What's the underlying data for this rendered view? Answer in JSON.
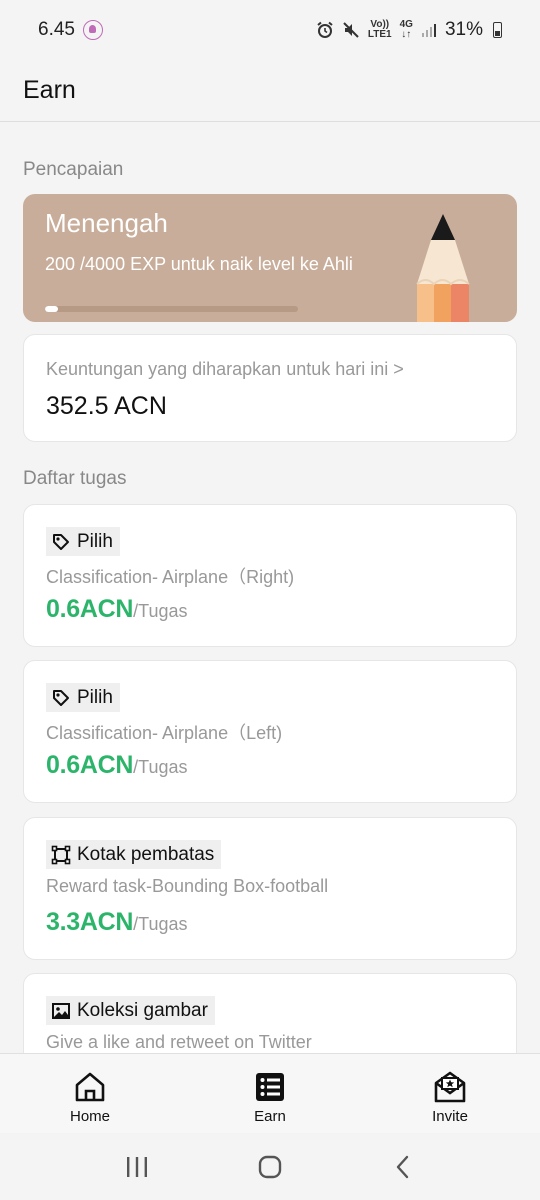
{
  "status_bar": {
    "time": "6.45",
    "volte_top": "Vo))",
    "volte_bottom": "LTE1",
    "network": "4G",
    "battery": "31%"
  },
  "header": {
    "title": "Earn"
  },
  "achievement": {
    "section_label": "Pencapaian",
    "level_name": "Menengah",
    "progress_text": "200 /4000 EXP untuk naik level ke Ahli",
    "progress_fraction": 0.05
  },
  "earnings": {
    "label": "Keuntungan yang diharapkan untuk hari ini >",
    "value": "352.5 ACN"
  },
  "tasks": {
    "section_label": "Daftar tugas",
    "items": [
      {
        "tag": "Pilih",
        "icon": "tag-icon",
        "desc": "Classification- Airplane（Right)",
        "amount": "0.6ACN",
        "unit": "/Tugas"
      },
      {
        "tag": "Pilih",
        "icon": "tag-icon",
        "desc": "Classification- Airplane（Left)",
        "amount": "0.6ACN",
        "unit": "/Tugas"
      },
      {
        "tag": "Kotak pembatas",
        "icon": "bounding-box-icon",
        "desc": "Reward task-Bounding Box-football",
        "amount": "3.3ACN",
        "unit": "/Tugas"
      },
      {
        "tag": "Koleksi gambar",
        "icon": "image-icon",
        "desc": "Give a like and retweet on Twitter",
        "amount": "",
        "unit": ""
      }
    ]
  },
  "bottom_nav": {
    "home": "Home",
    "earn": "Earn",
    "invite": "Invite"
  },
  "colors": {
    "level_card": "#c8ad9a",
    "reward_green": "#2cb56a"
  }
}
